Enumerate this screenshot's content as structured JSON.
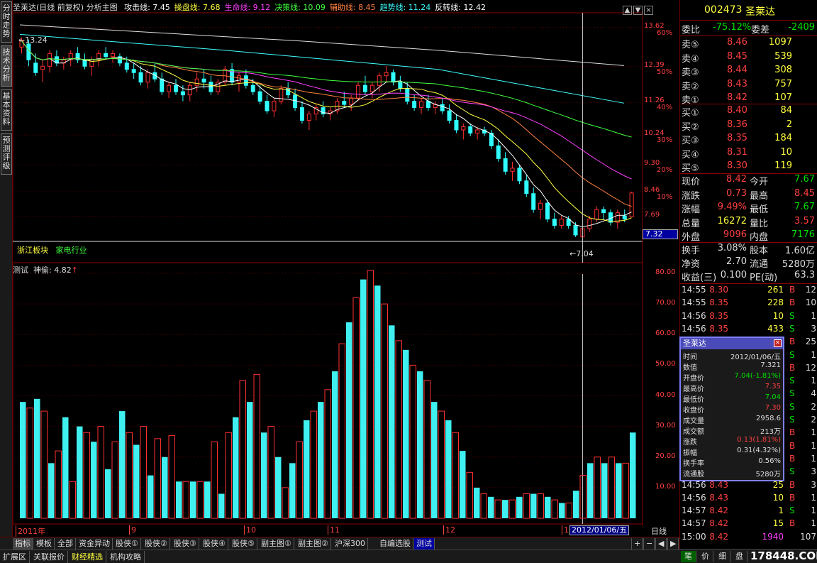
{
  "left_tabs": [
    "分时走势",
    "技术分析",
    "基本资料",
    "预测评级"
  ],
  "header": {
    "title": "圣莱达(日线 前复权) 分析主图",
    "items": [
      {
        "label": "攻击线: 7.45",
        "color": "#ffffff"
      },
      {
        "label": "操盘线: 7.68",
        "color": "#ffff40"
      },
      {
        "label": "生命线: 9.12",
        "color": "#ff40ff"
      },
      {
        "label": "决策线: 10.09",
        "color": "#40ff40"
      },
      {
        "label": "辅助线: 8.45",
        "color": "#ff8040"
      },
      {
        "label": "趋势线: 11.24",
        "color": "#40ffff"
      },
      {
        "label": "反转线: 12.42",
        "color": "#ffffff"
      }
    ]
  },
  "win_buttons": [
    "▲",
    "▼",
    "×"
  ],
  "sector": {
    "board": "浙江板块",
    "industry": "家电行业"
  },
  "annotations": {
    "high": "13.24",
    "low": "7.04"
  },
  "price_axis": [
    {
      "price": "13.62",
      "pct": "60%"
    },
    {
      "price": "12.39",
      "pct": "50%"
    },
    {
      "price": "11.26",
      "pct": "40%"
    },
    {
      "price": "10.24",
      "pct": "30%"
    },
    {
      "price": "9.30",
      "pct": "20%"
    },
    {
      "price": "8.46",
      "pct": "10%"
    },
    {
      "price": "7.69",
      "pct": ""
    }
  ],
  "cursor_price": "7.32",
  "indicator": {
    "name": "测试",
    "line": "神偷: 4.82",
    "arrow": "↑"
  },
  "ind_axis": [
    "80.00",
    "70.00",
    "60.00",
    "50.00",
    "40.00",
    "30.00",
    "20.00",
    "10.00"
  ],
  "time_axis": {
    "labels": [
      "2011年",
      "9",
      "10",
      "11",
      "12",
      "1"
    ],
    "cursor": "2012/01/06/五",
    "period": "日线"
  },
  "quote": {
    "code": "002473",
    "name": "圣莱达",
    "weibi_label": "委比",
    "weibi": "-75.12%",
    "weicha_label": "委差",
    "weicha": "-2409",
    "sells": [
      {
        "label": "卖⑤",
        "price": "8.46",
        "vol": "1097"
      },
      {
        "label": "卖④",
        "price": "8.45",
        "vol": "539"
      },
      {
        "label": "卖③",
        "price": "8.44",
        "vol": "308"
      },
      {
        "label": "卖②",
        "price": "8.43",
        "vol": "757"
      },
      {
        "label": "卖①",
        "price": "8.42",
        "vol": "107"
      }
    ],
    "buys": [
      {
        "label": "买①",
        "price": "8.40",
        "vol": "84"
      },
      {
        "label": "买②",
        "price": "8.36",
        "vol": "2"
      },
      {
        "label": "买③",
        "price": "8.35",
        "vol": "184"
      },
      {
        "label": "买④",
        "price": "8.31",
        "vol": "10"
      },
      {
        "label": "买⑤",
        "price": "8.30",
        "vol": "119"
      }
    ],
    "stats": [
      {
        "k1": "现价",
        "v1": "8.42",
        "c1": "#ff4040",
        "k2": "今开",
        "v2": "7.67",
        "c2": "#00e000"
      },
      {
        "k1": "涨跌",
        "v1": "0.73",
        "c1": "#ff4040",
        "k2": "最高",
        "v2": "8.45",
        "c2": "#ff4040"
      },
      {
        "k1": "涨幅",
        "v1": "9.49%",
        "c1": "#ff4040",
        "k2": "最低",
        "v2": "7.67",
        "c2": "#00e000"
      },
      {
        "k1": "总量",
        "v1": "16272",
        "c1": "#ffff40",
        "k2": "量比",
        "v2": "3.57",
        "c2": "#ff4040"
      },
      {
        "k1": "外盘",
        "v1": "9096",
        "c1": "#ff4040",
        "k2": "内盘",
        "v2": "7176",
        "c2": "#00e000"
      }
    ],
    "fin": [
      {
        "k1": "换手",
        "v1": "3.08%",
        "k2": "股本",
        "v2": "1.60亿"
      },
      {
        "k1": "净资",
        "v1": "2.70",
        "k2": "流通",
        "v2": "5280万"
      },
      {
        "k1": "收益(三)",
        "v1": "0.100",
        "k2": "PE(动)",
        "v2": "63.3"
      }
    ],
    "ticks": [
      {
        "t": "14:55",
        "p": "8.30",
        "v": "261",
        "d": "B",
        "n": "12"
      },
      {
        "t": "14:55",
        "p": "8.35",
        "v": "228",
        "d": "B",
        "n": "10"
      },
      {
        "t": "14:56",
        "p": "8.35",
        "v": "10",
        "d": "S",
        "n": "1"
      },
      {
        "t": "14:56",
        "p": "8.35",
        "v": "433",
        "d": "S",
        "n": "3"
      },
      {
        "t": "",
        "p": "",
        "v": "",
        "d": "B",
        "n": "25"
      },
      {
        "t": "",
        "p": "",
        "v": "",
        "d": "S",
        "n": "1"
      },
      {
        "t": "",
        "p": "",
        "v": "",
        "d": "B",
        "n": "12"
      },
      {
        "t": "",
        "p": "",
        "v": "",
        "d": "S",
        "n": "1"
      },
      {
        "t": "",
        "p": "",
        "v": "",
        "d": "S",
        "n": "4"
      },
      {
        "t": "",
        "p": "",
        "v": "",
        "d": "S",
        "n": "2"
      },
      {
        "t": "",
        "p": "",
        "v": "",
        "d": "S",
        "n": "2"
      },
      {
        "t": "",
        "p": "",
        "v": "",
        "d": "B",
        "n": "1"
      },
      {
        "t": "",
        "p": "",
        "v": "",
        "d": "B",
        "n": "1"
      },
      {
        "t": "",
        "p": "",
        "v": "",
        "d": "B",
        "n": "1"
      },
      {
        "t": "",
        "p": "",
        "v": "",
        "d": "S",
        "n": "3"
      },
      {
        "t": "14:56",
        "p": "8.43",
        "v": "25",
        "d": "B",
        "n": "3"
      },
      {
        "t": "14:56",
        "p": "8.43",
        "v": "10",
        "d": "B",
        "n": "1"
      },
      {
        "t": "14:57",
        "p": "8.42",
        "v": "1",
        "d": "S",
        "n": "1"
      },
      {
        "t": "14:57",
        "p": "8.42",
        "v": "15",
        "d": "B",
        "n": "1"
      },
      {
        "t": "15:00",
        "p": "8.42",
        "v": "1940",
        "d": "",
        "n": "107"
      }
    ],
    "bottom_tabs": [
      "笔",
      "价",
      "细",
      "盘"
    ],
    "watermark": "178448.COM"
  },
  "popup": {
    "title": "圣莱达",
    "rows": [
      {
        "k": "时间",
        "v": "2012/01/06/五",
        "c": "#dddddd"
      },
      {
        "k": "数值",
        "v": "7.321",
        "c": "#dddddd"
      },
      {
        "k": "开盘价",
        "v": "7.04(-1.81%)",
        "c": "#00e000"
      },
      {
        "k": "最高价",
        "v": "7.35",
        "c": "#ff4040"
      },
      {
        "k": "最低价",
        "v": "7.04",
        "c": "#00e000"
      },
      {
        "k": "收盘价",
        "v": "7.30",
        "c": "#ff4040"
      },
      {
        "k": "成交量",
        "v": "2958.6",
        "c": "#dddddd"
      },
      {
        "k": "成交额",
        "v": "213万",
        "c": "#dddddd"
      },
      {
        "k": "涨跌",
        "v": "0.13(1.81%)",
        "c": "#ff4040"
      },
      {
        "k": "振幅",
        "v": "0.31(4.32%)",
        "c": "#dddddd"
      },
      {
        "k": "换手率",
        "v": "0.56%",
        "c": "#dddddd"
      },
      {
        "k": "流通股",
        "v": "5280万",
        "c": "#dddddd"
      }
    ]
  },
  "bottom_tabs": [
    "指标",
    "模板",
    "全部",
    "资金异动",
    "股侠①",
    "股侠②",
    "股侠③",
    "股侠④",
    "股侠⑤",
    "副主图①",
    "副主图②",
    "沪深300",
    "自编选股",
    "测试"
  ],
  "status_tabs": [
    "扩展区",
    "关联报价",
    "财经精选",
    "机构攻略"
  ],
  "nav_buttons": [
    "+",
    "−",
    "◀",
    "▶"
  ],
  "chart_data": [
    {
      "type": "candlestick",
      "title": "圣莱达(日线 前复权) 分析主图",
      "y_range": [
        6.9,
        13.9
      ],
      "ohlc": [
        [
          13.0,
          13.3,
          12.8,
          13.2
        ],
        [
          13.1,
          13.24,
          12.4,
          12.6
        ],
        [
          12.5,
          12.8,
          12.1,
          12.2
        ],
        [
          12.3,
          12.6,
          11.9,
          12.4
        ],
        [
          12.4,
          12.9,
          12.2,
          12.8
        ],
        [
          12.7,
          12.9,
          12.4,
          12.5
        ],
        [
          12.5,
          12.7,
          12.3,
          12.6
        ],
        [
          12.6,
          12.9,
          12.4,
          12.8
        ],
        [
          12.8,
          13.0,
          12.5,
          12.6
        ],
        [
          12.6,
          12.8,
          12.3,
          12.4
        ],
        [
          12.4,
          12.7,
          12.1,
          12.6
        ],
        [
          12.6,
          12.9,
          12.4,
          12.8
        ],
        [
          12.8,
          13.0,
          12.6,
          12.7
        ],
        [
          12.7,
          12.9,
          12.5,
          12.8
        ],
        [
          12.7,
          12.8,
          12.4,
          12.5
        ],
        [
          12.5,
          12.7,
          12.2,
          12.3
        ],
        [
          12.3,
          12.5,
          12.0,
          12.2
        ],
        [
          12.2,
          12.4,
          11.8,
          11.9
        ],
        [
          11.9,
          12.3,
          11.7,
          12.2
        ],
        [
          12.2,
          12.5,
          11.9,
          12.0
        ],
        [
          12.0,
          12.2,
          11.5,
          11.6
        ],
        [
          11.6,
          11.9,
          11.4,
          11.8
        ],
        [
          11.8,
          12.0,
          11.5,
          11.6
        ],
        [
          11.6,
          11.8,
          11.3,
          11.5
        ],
        [
          11.5,
          11.9,
          11.3,
          11.8
        ],
        [
          11.8,
          12.2,
          11.6,
          12.0
        ],
        [
          12.0,
          12.3,
          11.7,
          11.9
        ],
        [
          11.9,
          12.1,
          11.5,
          11.6
        ],
        [
          11.6,
          12.0,
          11.5,
          11.9
        ],
        [
          11.9,
          12.4,
          11.8,
          12.3
        ],
        [
          12.3,
          12.5,
          11.8,
          11.9
        ],
        [
          11.9,
          12.2,
          11.6,
          12.1
        ],
        [
          12.1,
          12.3,
          11.7,
          11.8
        ],
        [
          11.8,
          12.0,
          11.5,
          11.6
        ],
        [
          11.6,
          11.8,
          11.2,
          11.3
        ],
        [
          11.3,
          11.5,
          10.9,
          11.0
        ],
        [
          11.0,
          11.4,
          10.8,
          11.3
        ],
        [
          11.3,
          11.8,
          11.2,
          11.7
        ],
        [
          11.7,
          11.9,
          11.4,
          11.5
        ],
        [
          11.5,
          11.7,
          11.0,
          11.1
        ],
        [
          11.1,
          11.3,
          10.6,
          10.7
        ],
        [
          10.7,
          11.0,
          10.4,
          10.9
        ],
        [
          10.9,
          11.2,
          10.7,
          11.1
        ],
        [
          11.1,
          11.3,
          10.8,
          10.9
        ],
        [
          10.9,
          11.1,
          10.7,
          11.0
        ],
        [
          11.0,
          11.4,
          10.9,
          11.3
        ],
        [
          11.3,
          11.6,
          11.1,
          11.2
        ],
        [
          11.2,
          11.5,
          11.0,
          11.4
        ],
        [
          11.4,
          11.9,
          11.3,
          11.8
        ],
        [
          11.8,
          12.1,
          11.5,
          11.6
        ],
        [
          11.6,
          11.9,
          11.4,
          11.8
        ],
        [
          11.8,
          12.2,
          11.6,
          12.1
        ],
        [
          12.1,
          12.4,
          11.9,
          12.2
        ],
        [
          12.2,
          12.3,
          11.8,
          11.9
        ],
        [
          11.9,
          12.1,
          11.6,
          11.7
        ],
        [
          11.7,
          11.9,
          11.2,
          11.3
        ],
        [
          11.3,
          11.5,
          11.0,
          11.1
        ],
        [
          11.1,
          11.4,
          10.9,
          11.3
        ],
        [
          11.3,
          11.5,
          11.0,
          11.1
        ],
        [
          11.1,
          11.3,
          10.9,
          11.2
        ],
        [
          11.2,
          11.4,
          10.9,
          11.0
        ],
        [
          11.0,
          11.2,
          10.6,
          10.7
        ],
        [
          10.7,
          10.9,
          10.3,
          10.4
        ],
        [
          10.4,
          10.6,
          10.1,
          10.5
        ],
        [
          10.5,
          10.6,
          10.2,
          10.3
        ],
        [
          10.3,
          10.5,
          10.1,
          10.4
        ],
        [
          10.4,
          10.5,
          10.2,
          10.3
        ],
        [
          10.3,
          10.4,
          9.8,
          9.9
        ],
        [
          9.9,
          10.1,
          9.4,
          9.5
        ],
        [
          9.5,
          9.7,
          9.0,
          9.1
        ],
        [
          9.1,
          9.4,
          8.8,
          9.2
        ],
        [
          9.2,
          9.3,
          8.7,
          8.8
        ],
        [
          8.8,
          9.0,
          8.3,
          8.4
        ],
        [
          8.4,
          8.6,
          7.8,
          7.9
        ],
        [
          7.9,
          8.2,
          7.6,
          8.1
        ],
        [
          8.1,
          8.2,
          7.5,
          7.6
        ],
        [
          7.6,
          7.8,
          7.3,
          7.4
        ],
        [
          7.4,
          7.7,
          7.3,
          7.6
        ],
        [
          7.6,
          7.7,
          7.3,
          7.4
        ],
        [
          7.4,
          7.5,
          7.04,
          7.1
        ],
        [
          7.04,
          7.35,
          7.04,
          7.3
        ],
        [
          7.3,
          7.7,
          7.2,
          7.6
        ],
        [
          7.6,
          8.0,
          7.5,
          7.9
        ],
        [
          7.9,
          8.0,
          7.6,
          7.8
        ],
        [
          7.8,
          7.9,
          7.4,
          7.5
        ],
        [
          7.5,
          7.9,
          7.3,
          7.8
        ],
        [
          7.7,
          7.9,
          7.5,
          7.6
        ],
        [
          7.67,
          8.45,
          7.67,
          8.42
        ]
      ]
    },
    {
      "type": "bar",
      "title": "神偷",
      "y_range": [
        0,
        80
      ],
      "values": [
        38,
        36,
        39,
        35,
        18,
        22,
        33,
        12,
        30,
        28,
        25,
        30,
        16,
        25,
        35,
        28,
        24,
        30,
        14,
        26,
        20,
        27,
        12,
        12,
        12,
        12,
        12,
        25,
        8,
        28,
        33,
        45,
        38,
        47,
        28,
        30,
        20,
        10,
        18,
        25,
        32,
        35,
        38,
        42,
        48,
        57,
        64,
        72,
        78,
        81,
        76,
        70,
        63,
        58,
        55,
        50,
        48,
        45,
        38,
        35,
        32,
        28,
        22,
        15,
        10,
        8,
        7,
        6,
        6,
        6,
        7,
        8,
        8,
        8,
        7,
        6,
        5,
        5,
        9,
        14,
        18,
        20,
        18,
        20,
        18,
        18,
        28
      ]
    }
  ]
}
